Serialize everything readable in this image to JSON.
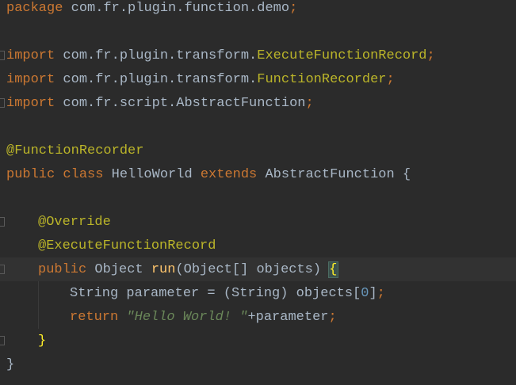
{
  "code": {
    "line_1": {
      "kw": "package",
      "pkg": " com.fr.plugin.function.demo",
      "semi": ";"
    },
    "line_3": {
      "kw": "import",
      "pkg": " com.fr.plugin.transform.",
      "cls": "ExecuteFunctionRecord",
      "semi": ";"
    },
    "line_4": {
      "kw": "import",
      "pkg": " com.fr.plugin.transform.",
      "cls": "FunctionRecorder",
      "semi": ";"
    },
    "line_5": {
      "kw": "import",
      "pkg": " com.fr.script.AbstractFunction",
      "semi": ";"
    },
    "line_7": {
      "ann": "@FunctionRecorder"
    },
    "line_8": {
      "kw1": "public class",
      "name": " HelloWorld ",
      "kw2": "extends",
      "rest": " AbstractFunction {"
    },
    "line_10": {
      "ann": "@Override"
    },
    "line_11": {
      "ann": "@ExecuteFunctionRecord"
    },
    "line_12": {
      "kw": "public",
      "type": " Object ",
      "method": "run",
      "params": "(Object[] objects) ",
      "brace": "{"
    },
    "line_13": {
      "text1": "String parameter = (String) objects[",
      "num": "0",
      "text2": "]",
      "semi": ";"
    },
    "line_14": {
      "kw": "return",
      "str": "\"Hello World! \"",
      "rest": "+parameter",
      "semi": ";"
    },
    "line_15": {
      "brace": "}"
    },
    "line_16": {
      "brace": "}"
    }
  },
  "colors": {
    "background": "#2b2b2b",
    "keyword": "#cc7832",
    "annotation": "#bbb529",
    "string": "#6a8759",
    "number": "#6897bb",
    "method": "#ffc66d",
    "text": "#a9b7c6"
  }
}
